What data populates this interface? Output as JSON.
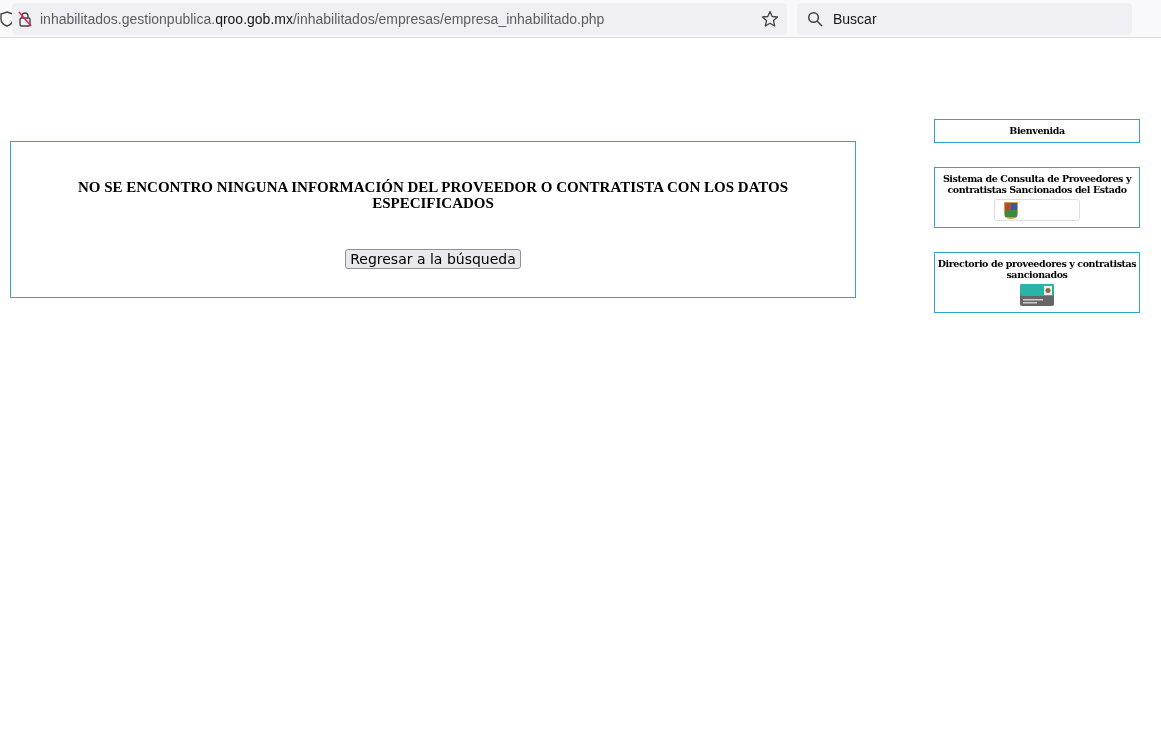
{
  "browser": {
    "url": [
      {
        "text": "inhabilitados.gestionpublica.",
        "highlight": false
      },
      {
        "text": "qroo.gob.mx",
        "highlight": true
      },
      {
        "text": "/inhabilitados/empresas/empresa_inhabilitado.php",
        "highlight": false
      }
    ],
    "search": {
      "placeholder": "Buscar"
    }
  },
  "message": {
    "text": "NO SE ENCONTRO NINGUNA INFORMACIÓN DEL PROVEEDOR O CONTRATISTA CON LOS DATOS ESPECIFICADOS",
    "button": "Regresar a la búsqueda"
  },
  "sidebar": [
    {
      "title": "Bienvenida",
      "kind": "plain"
    },
    {
      "title": "Sistema de Consulta de Proveedores y contratistas Sancionados del Estado",
      "kind": "emblem"
    },
    {
      "title": "Directorio de proveedores y contratistas sancionados",
      "kind": "badge"
    }
  ]
}
